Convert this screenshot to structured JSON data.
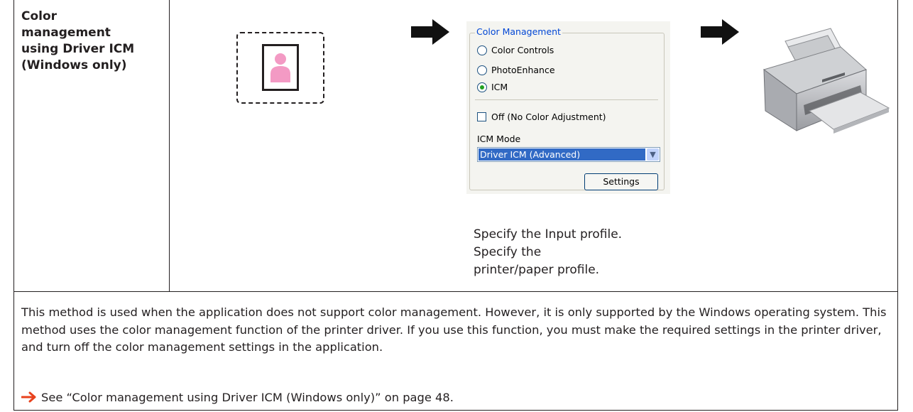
{
  "row_title": "Color\nmanagement\nusing Driver ICM\n(Windows only)",
  "dialog": {
    "group_title": "Color Management",
    "radios": [
      {
        "label": "Color Controls",
        "selected": false
      },
      {
        "label": "PhotoEnhance",
        "selected": false
      },
      {
        "label": "ICM",
        "selected": true
      }
    ],
    "checkbox_label": "Off (No Color Adjustment)",
    "checkbox_checked": false,
    "icm_mode_label": "ICM Mode",
    "icm_mode_value": "Driver ICM (Advanced)",
    "settings_button": "Settings"
  },
  "caption": {
    "line1": "Specify the Input profile.",
    "line2": "Specify the",
    "line3": "printer/paper profile."
  },
  "description": "This method is used when the application does not support color management. However, it is only supported by the Windows operating system. This method uses the color management function of the printer driver. If you use this function, you must make the required settings in the printer driver, and turn off the color management settings in the application.",
  "reference": "See “Color management using Driver ICM (Windows only)” on page 48.",
  "icons": {
    "document": "document-icon",
    "arrow": "arrow-right-icon",
    "printer": "printer-icon",
    "reference_arrow": "reference-arrow-icon"
  },
  "colors": {
    "text": "#231f20",
    "reference_arrow": "#e8421d",
    "selection": "#316ac5",
    "dialog_title": "#0046d5",
    "person": "#f39ac4"
  }
}
